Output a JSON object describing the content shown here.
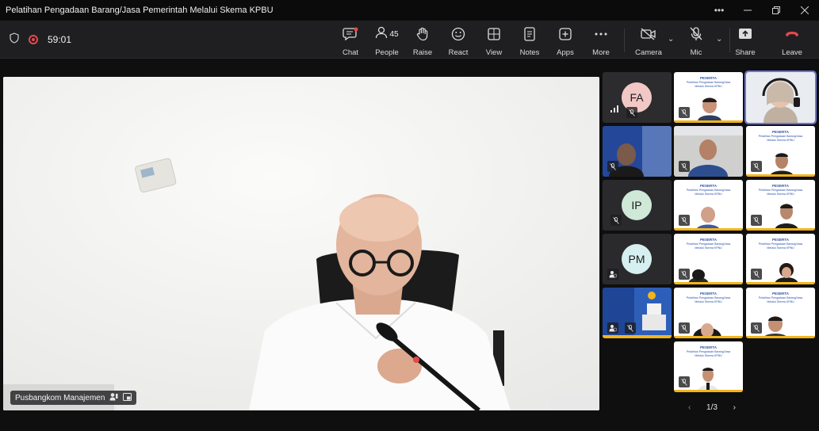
{
  "window": {
    "title": "Pelatihan Pengadaan Barang/Jasa Pemerintah Melalui Skema KPBU",
    "controls": [
      "more-icon",
      "minimize-icon",
      "restore-icon",
      "close-icon"
    ]
  },
  "meeting": {
    "timer": "59:01"
  },
  "toolbar": {
    "chat": "Chat",
    "people": "People",
    "people_count": "45",
    "raise": "Raise",
    "react": "React",
    "view": "View",
    "notes": "Notes",
    "apps": "Apps",
    "more": "More",
    "camera": "Camera",
    "mic": "Mic",
    "share": "Share",
    "leave": "Leave"
  },
  "colors": {
    "leave": "#e5484d",
    "selected_outline": "#6b73d6",
    "toolbar_bg": "#1f1f21"
  },
  "main_video": {
    "name": "Pusbangkom Manajemen"
  },
  "participants": [
    {
      "initials": "FA",
      "avatar_color": "#f2c8c6"
    },
    {
      "initials": "IP",
      "avatar_color": "#cfe8d8"
    },
    {
      "initials": "PM",
      "avatar_color": "#d6eff0"
    }
  ],
  "peserta": {
    "title": "PESERTA",
    "subtitle_1": "Pelatihan Pengadaan Barang/Jasa",
    "subtitle_2": "Melalui Skema KPBU"
  },
  "pager": {
    "label": "1/3"
  }
}
